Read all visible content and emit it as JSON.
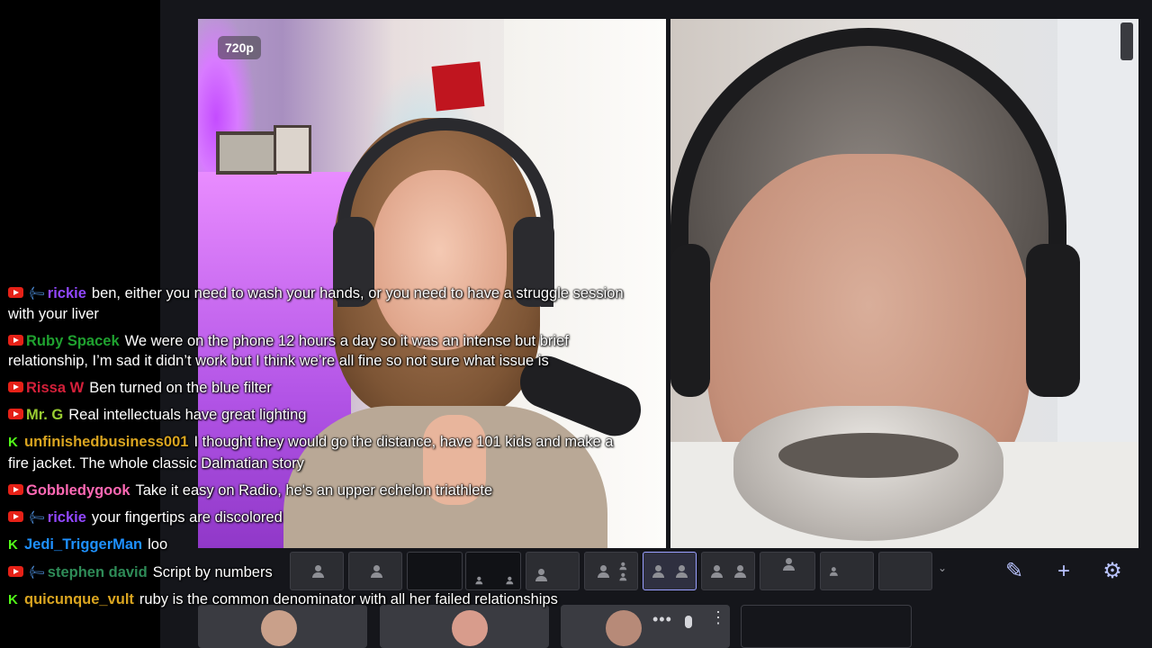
{
  "stage": {
    "quality_badge": "720p",
    "left_participant": "",
    "right_participant": ""
  },
  "chat": {
    "messages": [
      {
        "icons": [
          "youtube",
          "wrench"
        ],
        "user": "rickie",
        "user_color": "#9147ff",
        "text": "ben, either you need to wash your hands, or you need to have a struggle session with your liver"
      },
      {
        "icons": [
          "youtube"
        ],
        "user": "Ruby Spacek",
        "user_color": "#1fa12f",
        "text": "We were on the phone 12 hours a day so it was an intense but brief relationship, I’m sad it didn’t work but I think we’re all fine so not sure what issue is"
      },
      {
        "icons": [
          "youtube"
        ],
        "user": "Rissa W",
        "user_color": "#d4203a",
        "text": "Ben turned on the blue filter"
      },
      {
        "icons": [
          "youtube"
        ],
        "user": "Mr. G",
        "user_color": "#9acd32",
        "text": "Real intellectuals have great lighting"
      },
      {
        "icons": [
          "kick"
        ],
        "user": "unfinishedbusiness001",
        "user_color": "#daa520",
        "text": "I thought they would go the distance, have 101 kids and make a fire jacket. The whole classic Dalmatian story"
      },
      {
        "icons": [
          "youtube"
        ],
        "user": "Gobbledygook",
        "user_color": "#ff69b4",
        "text": "Take it easy on Radio, he's an upper echelon triathlete"
      },
      {
        "icons": [
          "youtube",
          "wrench"
        ],
        "user": "rickie",
        "user_color": "#9147ff",
        "text": "your fingertips are discolored"
      },
      {
        "icons": [
          "kick"
        ],
        "user": "Jedi_TriggerMan",
        "user_color": "#1e90ff",
        "text": "loo"
      },
      {
        "icons": [
          "youtube",
          "wrench"
        ],
        "user": "stephen david",
        "user_color": "#2e8b57",
        "text": "Script by numbers"
      },
      {
        "icons": [
          "kick"
        ],
        "user": "quicunque_vult",
        "user_color": "#daa520",
        "text": "ruby is the common denominator with all her failed relationships"
      }
    ]
  },
  "layout_bar": {
    "layouts": [
      "solo",
      "solo-framed",
      "empty-grid",
      "two-small",
      "pip",
      "side-grid",
      "two-up-active",
      "two-up-dim",
      "banner",
      "list-1",
      "screen"
    ],
    "active_layout": "two-up-active",
    "tools": [
      "pencil-icon",
      "plus-icon",
      "gear-icon"
    ]
  },
  "colors": {
    "background": "#000000",
    "stage": "#15161b",
    "accent": "#b9c3ff"
  }
}
